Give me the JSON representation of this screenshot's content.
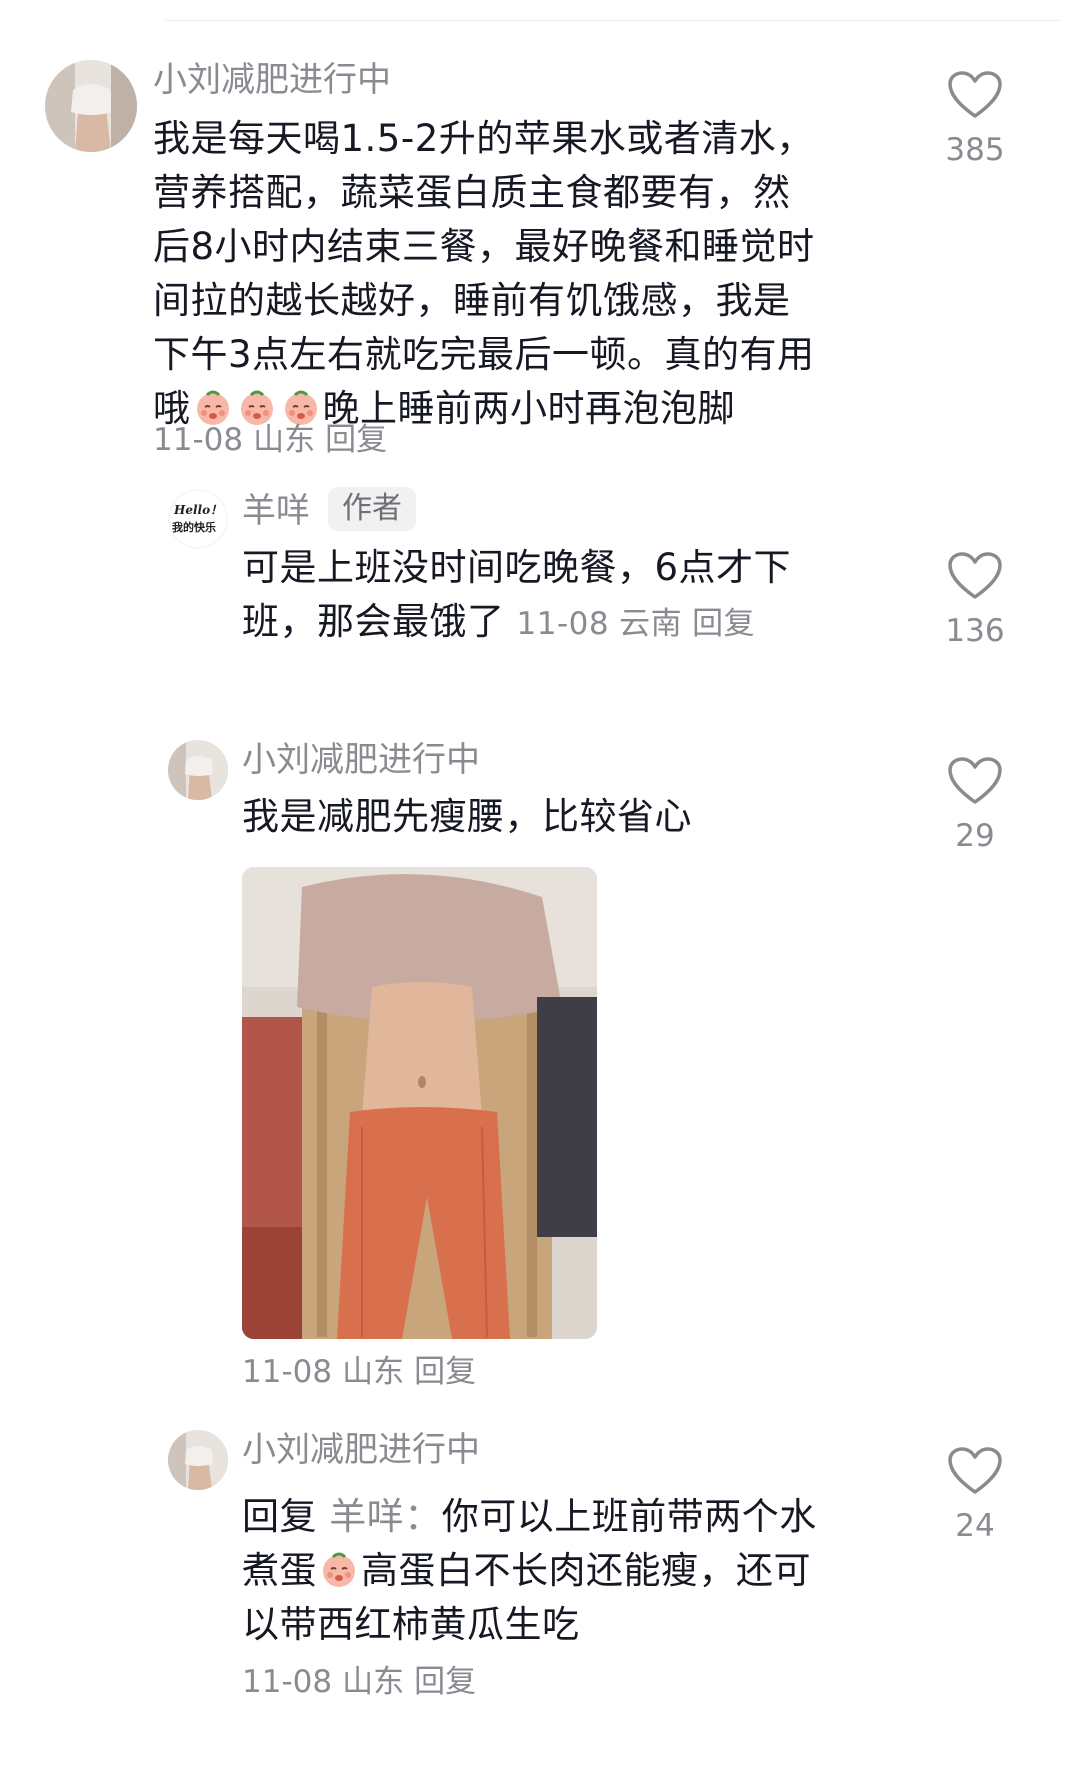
{
  "comments": [
    {
      "username": "小刘减肥进行中",
      "text_lines": [
        "我是每天喝1.5-2升的苹果水或者清水，",
        "营养搭配，蔬菜蛋白质主食都要有，然",
        "后8小时内结束三餐，最好晚餐和睡觉时",
        "间拉的越长越好，睡前有饥饿感，我是",
        "下午3点左右就吃完最后一顿。真的有用"
      ],
      "last_line_prefix": "哦",
      "last_line_suffix": "晚上睡前两小时再泡泡脚",
      "date": "11-08",
      "location": "山东",
      "reply_label": "回复",
      "likes": "385"
    },
    {
      "username": "羊咩",
      "badge": "作者",
      "avatar_text_1": "Hello！",
      "avatar_text_2": "我的快乐",
      "text_line_1": "可是上班没时间吃晚餐，6点才下",
      "text_line_2": "班，那会最饿了",
      "date": "11-08",
      "location": "云南",
      "reply_label": "回复",
      "likes": "136"
    },
    {
      "username": "小刘减肥进行中",
      "text": "我是减肥先瘦腰，比较省心",
      "date": "11-08",
      "location": "山东",
      "reply_label": "回复",
      "likes": "29"
    },
    {
      "username": "小刘减肥进行中",
      "reply_prefix": "回复",
      "reply_target": "羊咩：",
      "line_1_rest": "你可以上班前带两个水",
      "line_2_prefix": "煮蛋",
      "line_2_suffix": "高蛋白不长肉还能瘦，还可",
      "line_3": "以带西红柿黄瓜生吃",
      "date": "11-08",
      "location": "山东",
      "reply_label": "回复",
      "likes": "24"
    }
  ],
  "colors": {
    "text": "#161823",
    "secondary": "#8a8b91",
    "badge_bg": "#f1f1f2"
  },
  "icons": {
    "like": "heart-outline-icon",
    "emoji": "peach-face-emoji-icon"
  }
}
